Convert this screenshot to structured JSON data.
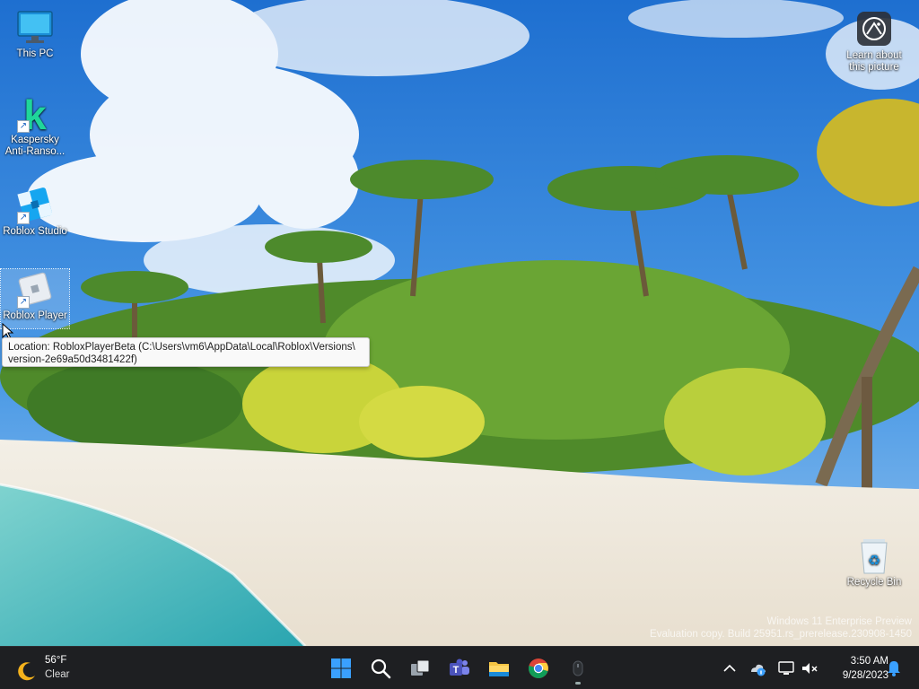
{
  "desktop": {
    "icons": [
      {
        "label": "This PC"
      },
      {
        "label": "Kaspersky Anti-Ranso..."
      },
      {
        "label": "Roblox Studio"
      },
      {
        "label": "Roblox Player"
      },
      {
        "label": "Learn about this picture"
      },
      {
        "label": "Recycle Bin"
      }
    ]
  },
  "tooltip": {
    "line1": "Location: RobloxPlayerBeta (C:\\Users\\vm6\\AppData\\Local\\Roblox\\Versions\\",
    "line2": "version-2e69a50d3481422f)"
  },
  "watermark": {
    "line1": "Windows 11 Enterprise Preview",
    "line2": "Evaluation copy. Build 25951.rs_prerelease.230908-1450"
  },
  "taskbar": {
    "weather": {
      "temp": "56°F",
      "condition": "Clear"
    },
    "apps": [
      "start-icon",
      "search-icon",
      "task-view-icon",
      "teams-icon",
      "file-explorer-icon",
      "chrome-icon",
      "roblox-player-icon"
    ],
    "clock": {
      "time": "3:50 AM",
      "date": "9/28/2023"
    }
  },
  "colors": {
    "taskbar": "#1e1f22",
    "accent": "#3aa0ff",
    "sky": "#2a78d0"
  }
}
